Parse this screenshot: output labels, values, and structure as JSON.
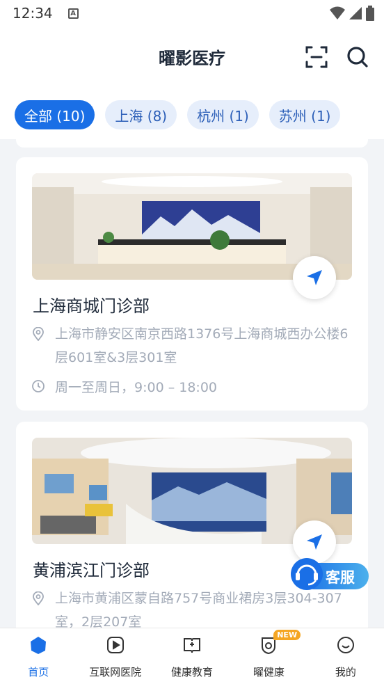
{
  "status_bar": {
    "time": "12:34",
    "notification_letter": "A"
  },
  "header": {
    "title": "曜影医疗"
  },
  "tabs": [
    {
      "label": "全部 (10)",
      "active": true
    },
    {
      "label": "上海 (8)",
      "active": false
    },
    {
      "label": "杭州 (1)",
      "active": false
    },
    {
      "label": "苏州 (1)",
      "active": false
    }
  ],
  "clinics": [
    {
      "name": "上海商城门诊部",
      "address": "上海市静安区南京西路1376号上海商城西办公楼6层601室&3层301室",
      "hours": "周一至周日，9:00 – 18:00"
    },
    {
      "name": "黄浦滨江门诊部",
      "address": "上海市黄浦区蒙自路757号商业裙房3层304-307室，2层207室"
    }
  ],
  "customer_service": {
    "label": "客服"
  },
  "bottom_nav": [
    {
      "label": "首页",
      "icon": "home-icon",
      "active": true
    },
    {
      "label": "互联网医院",
      "icon": "video-icon",
      "active": false
    },
    {
      "label": "健康教育",
      "icon": "book-icon",
      "active": false
    },
    {
      "label": "曜健康",
      "icon": "shield-icon",
      "active": false,
      "badge": "NEW"
    },
    {
      "label": "我的",
      "icon": "smile-icon",
      "active": false
    }
  ],
  "colors": {
    "primary": "#1a6fe6",
    "tab_inactive_bg": "#e6eefb",
    "muted_text": "#a3abb8",
    "badge": "#f5a623"
  }
}
